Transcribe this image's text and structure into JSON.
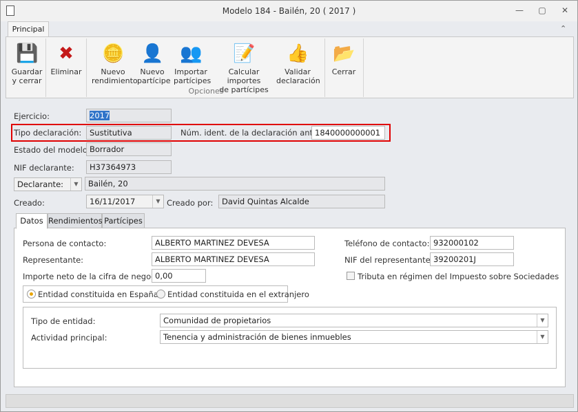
{
  "window": {
    "title": "Modelo 184 - Bailén, 20 ( 2017 )",
    "minimize": "—",
    "restore": "▢",
    "close": "✕"
  },
  "ribbon": {
    "tab": "Principal",
    "collapse": "⌃",
    "group_label": "Opciones",
    "buttons": [
      {
        "l1": "Guardar",
        "l2": "y cerrar",
        "icon": "💾"
      },
      {
        "l1": "Eliminar",
        "l2": "",
        "icon": "✖"
      },
      {
        "l1": "Nuevo",
        "l2": "rendimiento",
        "icon": "🪙"
      },
      {
        "l1": "Nuevo",
        "l2": "partícipe",
        "icon": "👤"
      },
      {
        "l1": "Importar",
        "l2": "partícipes",
        "icon": "👥"
      },
      {
        "l1": "Calcular importes",
        "l2": "de partícipes",
        "icon": "📝"
      },
      {
        "l1": "Validar",
        "l2": "declaración",
        "icon": "👍"
      },
      {
        "l1": "Cerrar",
        "l2": "",
        "icon": "📂"
      }
    ]
  },
  "form": {
    "ejercicio_label": "Ejercicio:",
    "ejercicio": "2017",
    "tipo_label": "Tipo declaración:",
    "tipo": "Sustitutiva",
    "num_label": "Núm. ident. de la declaración anterior:",
    "num": "1840000000001",
    "estado_label": "Estado del modelo:",
    "estado": "Borrador",
    "nif_label": "NIF declarante:",
    "nif": "H37364973",
    "declarante_select": "Declarante:",
    "declarante": "Bailén, 20",
    "creado_label": "Creado:",
    "creado": "16/11/2017",
    "creado_por_label": "Creado por:",
    "creado_por": "David Quintas Alcalde"
  },
  "tabs": [
    "Datos",
    "Rendimientos",
    "Partícipes"
  ],
  "datos": {
    "persona_label": "Persona de contacto:",
    "persona": "ALBERTO MARTINEZ DEVESA",
    "representante_label": "Representante:",
    "representante": "ALBERTO MARTINEZ DEVESA",
    "importe_label": "Importe neto de la cifra de negocios:",
    "importe": "0,00",
    "telefono_label": "Teléfono de contacto:",
    "telefono": "932000102",
    "nif_rep_label": "NIF del representante:",
    "nif_rep": "39200201J",
    "tributa_label": "Tributa en régimen del Impuesto sobre Sociedades",
    "tributa_checked": false,
    "radio_espana": "Entidad constituida en España",
    "radio_extranjero": "Entidad constituida en el extranjero",
    "radio_selected": "espana",
    "tipo_entidad_label": "Tipo de entidad:",
    "tipo_entidad": "Comunidad de propietarios",
    "actividad_label": "Actividad principal:",
    "actividad": "Tenencia y administración de bienes inmuebles"
  },
  "colors": {
    "highlight": "#e00000",
    "selection": "#3074c9"
  }
}
